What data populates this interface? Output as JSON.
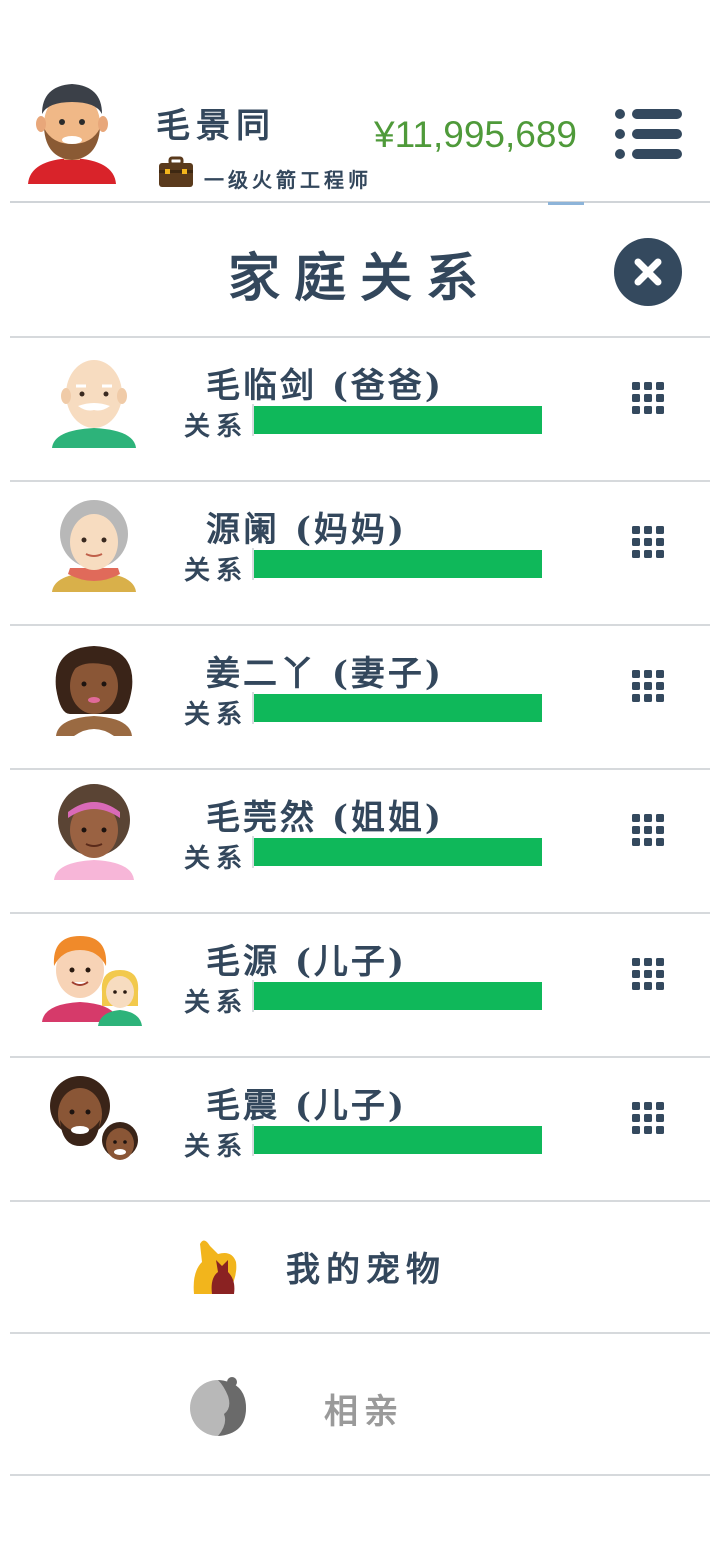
{
  "player": {
    "name": "毛景同",
    "job": "一级火箭工程师",
    "money": "¥11,995,689",
    "avatar_icon": "bearded-man-avatar-icon",
    "job_icon": "briefcase-icon"
  },
  "panel": {
    "title": "家庭关系",
    "close_icon": "close-icon"
  },
  "relations": [
    {
      "name": "毛临剑 (爸爸)",
      "label": "关系",
      "level": 1.0,
      "avatar": "old-bald-man-avatar-icon"
    },
    {
      "name": "源阑 (妈妈)",
      "label": "关系",
      "level": 1.0,
      "avatar": "old-woman-avatar-icon"
    },
    {
      "name": "姜二丫 (妻子)",
      "label": "关系",
      "level": 1.0,
      "avatar": "woman-dark-hair-avatar-icon"
    },
    {
      "name": "毛莞然 (姐姐)",
      "label": "关系",
      "level": 1.0,
      "avatar": "woman-curly-hair-avatar-icon"
    },
    {
      "name": "毛源 (儿子)",
      "label": "关系",
      "level": 1.0,
      "avatar": "son-with-partner-avatar-icon"
    },
    {
      "name": "毛震 (儿子)",
      "label": "关系",
      "level": 1.0,
      "avatar": "son-with-child-avatar-icon"
    }
  ],
  "menu": {
    "pets_label": "我的宠物",
    "pets_icon": "dog-cat-icon",
    "dating_label": "相亲",
    "dating_icon": "couple-silhouette-icon"
  },
  "colors": {
    "primary": "#34495e",
    "money": "#4f9a3a",
    "bar": "#0fb85a"
  }
}
